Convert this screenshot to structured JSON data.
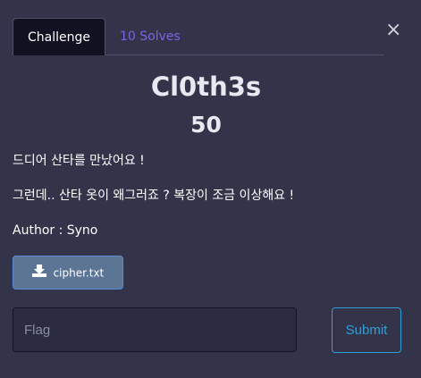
{
  "tabs": {
    "challenge_label": "Challenge",
    "solves_label": "10 Solves"
  },
  "close_glyph": "×",
  "challenge": {
    "name": "Cl0th3s",
    "value": "50",
    "description_lines": [
      "드디어 산타를 만났어요 !",
      "그런데.. 산타 옷이 왜그러죠 ? 복장이 조금 이상해요 !",
      "Author : Syno"
    ]
  },
  "file": {
    "icon": "download-icon",
    "label": "cipher.txt"
  },
  "form": {
    "flag_placeholder": "Flag",
    "flag_value": "",
    "submit_label": "Submit"
  },
  "colors": {
    "background": "#33334a",
    "active_tab": "#111122",
    "solves_link": "#7f62e6",
    "file_button": "#5c7595",
    "submit_accent": "#2da0d8"
  }
}
